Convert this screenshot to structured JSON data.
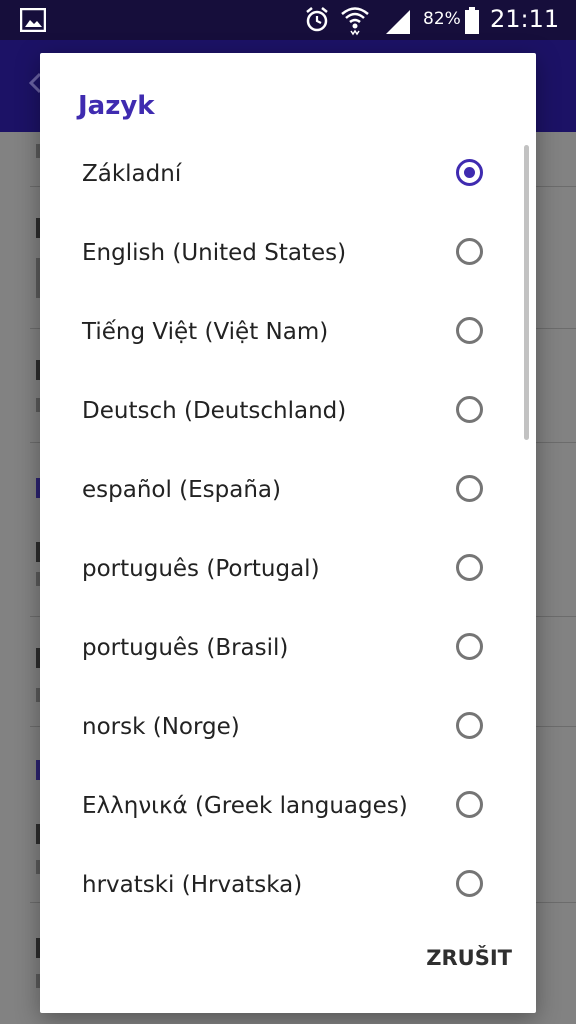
{
  "status_bar": {
    "battery_percent": "82%",
    "time": "21:11",
    "icons": [
      "gallery-notification-icon",
      "alarm-icon",
      "wifi-icon",
      "signal-icon",
      "battery-icon"
    ]
  },
  "dialog": {
    "title": "Jazyk",
    "selected_index": 0,
    "options": [
      {
        "label": "Základní",
        "checked": true
      },
      {
        "label": "English (United States)",
        "checked": false
      },
      {
        "label": "Tiếng Việt (Việt Nam)",
        "checked": false
      },
      {
        "label": "Deutsch (Deutschland)",
        "checked": false
      },
      {
        "label": "español (España)",
        "checked": false
      },
      {
        "label": "português (Portugal)",
        "checked": false
      },
      {
        "label": "português (Brasil)",
        "checked": false
      },
      {
        "label": "norsk (Norge)",
        "checked": false
      },
      {
        "label": "Ελληνικά (Greek languages)",
        "checked": false
      },
      {
        "label": "hrvatski (Hrvatska)",
        "checked": false
      }
    ],
    "cancel_label": "ZRUŠIT"
  },
  "colors": {
    "accent": "#3f2bb0",
    "app_bar": "#1c1266",
    "status_bar": "#160e3b"
  }
}
